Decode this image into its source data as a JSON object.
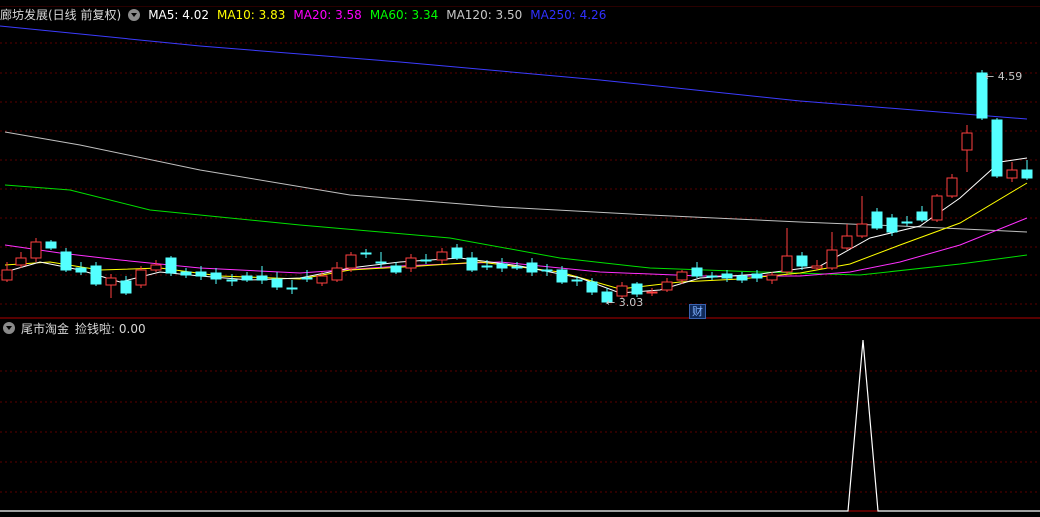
{
  "header": {
    "title": "廊坊发展(日线 前复权)",
    "mas": [
      {
        "label": "MA5: 4.02",
        "color": "#ffffff"
      },
      {
        "label": "MA10: 3.83",
        "color": "#ffff00"
      },
      {
        "label": "MA20: 3.58",
        "color": "#ff00ff"
      },
      {
        "label": "MA60: 3.34",
        "color": "#00ff00"
      },
      {
        "label": "MA120: 3.50",
        "color": "#c8c8c8"
      },
      {
        "label": "MA250: 4.26",
        "color": "#3030ff"
      }
    ]
  },
  "annotations": {
    "high": "4.59",
    "low": "3.03",
    "event": "财"
  },
  "indicator": {
    "name": "尾市淘金",
    "value_label": "捡钱啦: 0.00"
  },
  "colors": {
    "up": "#ff4040",
    "down": "#54ffff",
    "ma250": "#3c3cff",
    "ma120": "#c0c0c0",
    "ma60": "#00e000",
    "ma20": "#ff30ff",
    "ma10": "#ffff00",
    "ma5": "#ffffff",
    "grid": "#5a0000"
  }
}
